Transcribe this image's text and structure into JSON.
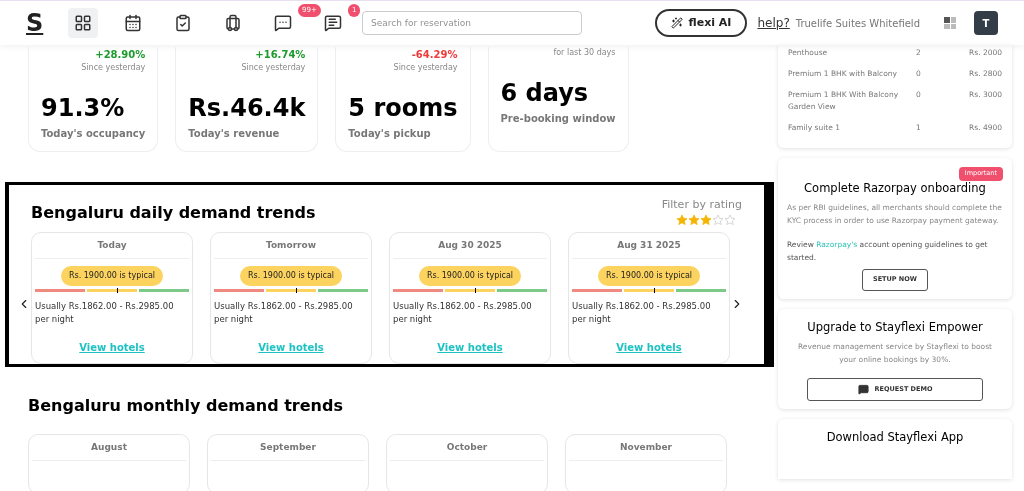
{
  "header": {
    "logo": "S",
    "nav": [
      {
        "kind": "grid",
        "selected": true
      },
      {
        "kind": "calendar",
        "selected": false
      },
      {
        "kind": "clipboard",
        "selected": false
      },
      {
        "kind": "luggage",
        "selected": false
      },
      {
        "kind": "chat",
        "selected": false,
        "badge": "99+"
      },
      {
        "kind": "note",
        "selected": false,
        "badge": "1"
      }
    ],
    "search": {
      "placeholder": "Search for reservation"
    },
    "ai_button": "flexi AI",
    "help": "help?",
    "property": "Truelife Suites Whitefield",
    "avatar": "T"
  },
  "stats": [
    {
      "trend": "+28.90%",
      "color": "#1c9a2c",
      "note": "Since yesterday",
      "value": "91.3%",
      "label": "Today's occupancy"
    },
    {
      "trend": "+16.74%",
      "color": "#1c9a2c",
      "note": "Since yesterday",
      "value": "Rs.46.4k",
      "label": "Today's revenue"
    },
    {
      "trend": "-64.29%",
      "color": "#f03a3a",
      "note": "Since yesterday",
      "value": "5 rooms",
      "label": "Today's pickup"
    },
    {
      "note": "for last 30 days",
      "value": "6 days",
      "label": "Pre-booking window"
    }
  ],
  "daily": {
    "title": "Bengaluru daily demand trends",
    "filter_label": "Filter by rating",
    "stars": 3,
    "days": [
      {
        "date": "Today",
        "typical": "Rs. 1900.00 is typical",
        "level": 0.53,
        "range": "Usually Rs.1862.00 - Rs.2985.00 per night",
        "link": "View hotels"
      },
      {
        "date": "Tomorrow",
        "typical": "Rs. 1900.00 is typical",
        "level": 0.53,
        "range": "Usually Rs.1862.00 - Rs.2985.00 per night",
        "link": "View hotels"
      },
      {
        "date": "Aug 30 2025",
        "typical": "Rs. 1900.00 is typical",
        "level": 0.53,
        "range": "Usually Rs.1862.00 - Rs.2985.00 per night",
        "link": "View hotels"
      },
      {
        "date": "Aug 31 2025",
        "typical": "Rs. 1900.00 is typical",
        "level": 0.53,
        "range": "Usually Rs.1862.00 - Rs.2985.00 per night",
        "link": "View hotels"
      }
    ]
  },
  "monthly": {
    "title": "Bengaluru monthly demand trends",
    "months": [
      "August",
      "September",
      "October",
      "November"
    ]
  },
  "rooms": [
    {
      "name": "Penthouse",
      "count": "2",
      "price": "Rs. 2000"
    },
    {
      "name": "Premium 1 BHK with Balcony",
      "count": "0",
      "price": "Rs. 2800"
    },
    {
      "name": "Premium 1 BHK With Balcony Garden View",
      "count": "0",
      "price": "Rs. 3000"
    },
    {
      "name": "Family suite 1",
      "count": "1",
      "price": "Rs. 4900"
    }
  ],
  "razorpay": {
    "badge": "Important",
    "title": "Complete Razorpay onboarding",
    "text": "As per RBI guidelines, all merchants should complete the KYC process in order to use Razorpay payment gateway.",
    "review_before": "Review",
    "review_link": "Razorpay's",
    "review_after": "account opening guidelines to get started.",
    "button": "SETUP NOW"
  },
  "empower": {
    "title": "Upgrade to Stayflexi Empower",
    "text": "Revenue management service by Stayflexi to boost your online bookings by 30%.",
    "button": "REQUEST DEMO"
  },
  "app": {
    "title": "Download Stayflexi App"
  }
}
